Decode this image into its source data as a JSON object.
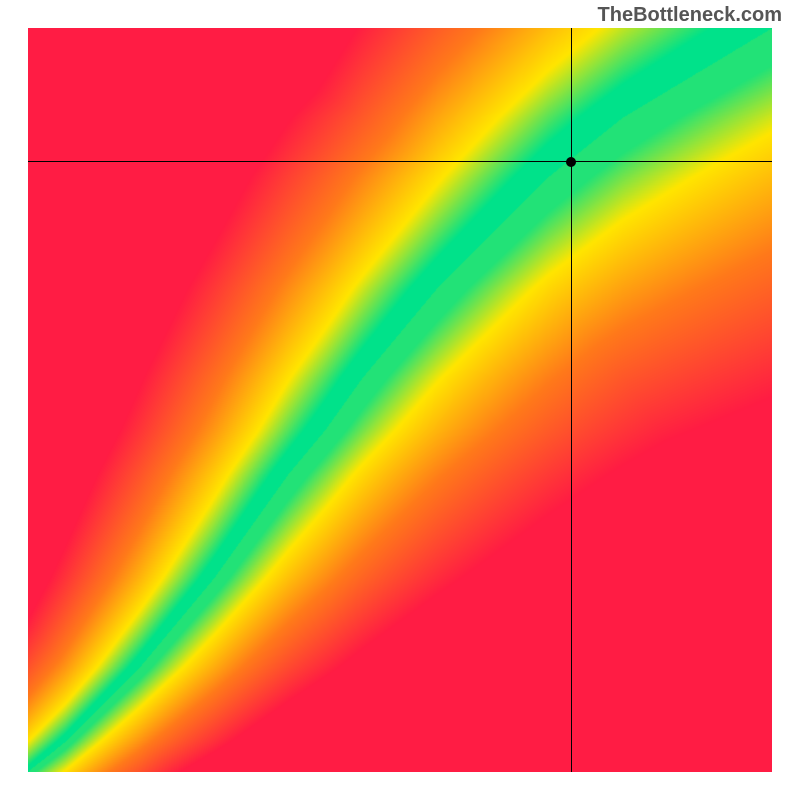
{
  "watermark": "TheBottleneck.com",
  "chart_data": {
    "type": "heatmap",
    "title": "",
    "xlabel": "",
    "ylabel": "",
    "xlim": [
      0,
      100
    ],
    "ylim": [
      0,
      100
    ],
    "crosshair": {
      "x": 73,
      "y": 82
    },
    "point": {
      "x": 73,
      "y": 82
    },
    "color_scale": {
      "low": "#ff1c44",
      "mid_low": "#ff7a1a",
      "mid": "#ffe600",
      "high": "#00e28a"
    },
    "description": "Diagonal ridge heatmap: optimal (green) band runs from lower-left to upper-right with slight S-curve; values fall off through yellow, orange to red away from ridge. Bottom-left corner pinches green to origin; top-right corner widens.",
    "ridge_samples": [
      {
        "x": 0,
        "y": 0
      },
      {
        "x": 5,
        "y": 4
      },
      {
        "x": 10,
        "y": 9
      },
      {
        "x": 15,
        "y": 14
      },
      {
        "x": 20,
        "y": 20
      },
      {
        "x": 25,
        "y": 26
      },
      {
        "x": 30,
        "y": 33
      },
      {
        "x": 35,
        "y": 40
      },
      {
        "x": 40,
        "y": 46
      },
      {
        "x": 45,
        "y": 53
      },
      {
        "x": 50,
        "y": 59
      },
      {
        "x": 55,
        "y": 65
      },
      {
        "x": 60,
        "y": 70
      },
      {
        "x": 65,
        "y": 75
      },
      {
        "x": 70,
        "y": 80
      },
      {
        "x": 75,
        "y": 84
      },
      {
        "x": 80,
        "y": 88
      },
      {
        "x": 85,
        "y": 91
      },
      {
        "x": 90,
        "y": 94
      },
      {
        "x": 95,
        "y": 97
      },
      {
        "x": 100,
        "y": 100
      }
    ],
    "band_half_width": 6
  }
}
